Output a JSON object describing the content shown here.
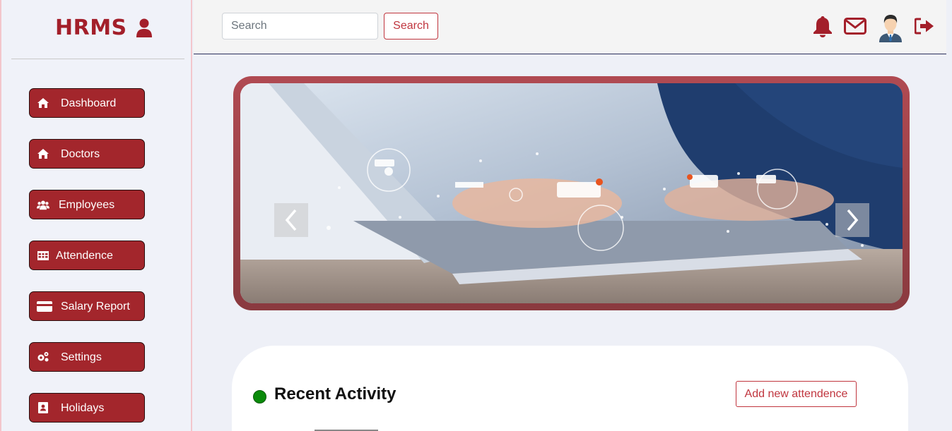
{
  "sidebar": {
    "brand": "HRMS",
    "brand_icon": "user-icon",
    "items": [
      {
        "label": "Dashboard",
        "icon": "home-icon"
      },
      {
        "label": "Doctors",
        "icon": "home-icon"
      },
      {
        "label": "Employees",
        "icon": "users-icon"
      },
      {
        "label": "Attendence",
        "icon": "table-icon"
      },
      {
        "label": "Salary Report",
        "icon": "credit-card-icon"
      },
      {
        "label": "Settings",
        "icon": "cogs-icon"
      },
      {
        "label": "Holidays",
        "icon": "contact-book-icon"
      }
    ]
  },
  "topbar": {
    "search_placeholder": "Search",
    "search_button": "Search",
    "icons": [
      "bell-icon",
      "envelope-icon",
      "avatar",
      "sign-out-icon"
    ]
  },
  "hero": {
    "prev_icon": "chevron-left-icon",
    "next_icon": "chevron-right-icon"
  },
  "activity": {
    "title": "Recent Activity",
    "add_button": "Add new attendence",
    "status_color": "#0a8a0a"
  },
  "colors": {
    "accent": "#a3262c",
    "outline": "#c0353e"
  }
}
